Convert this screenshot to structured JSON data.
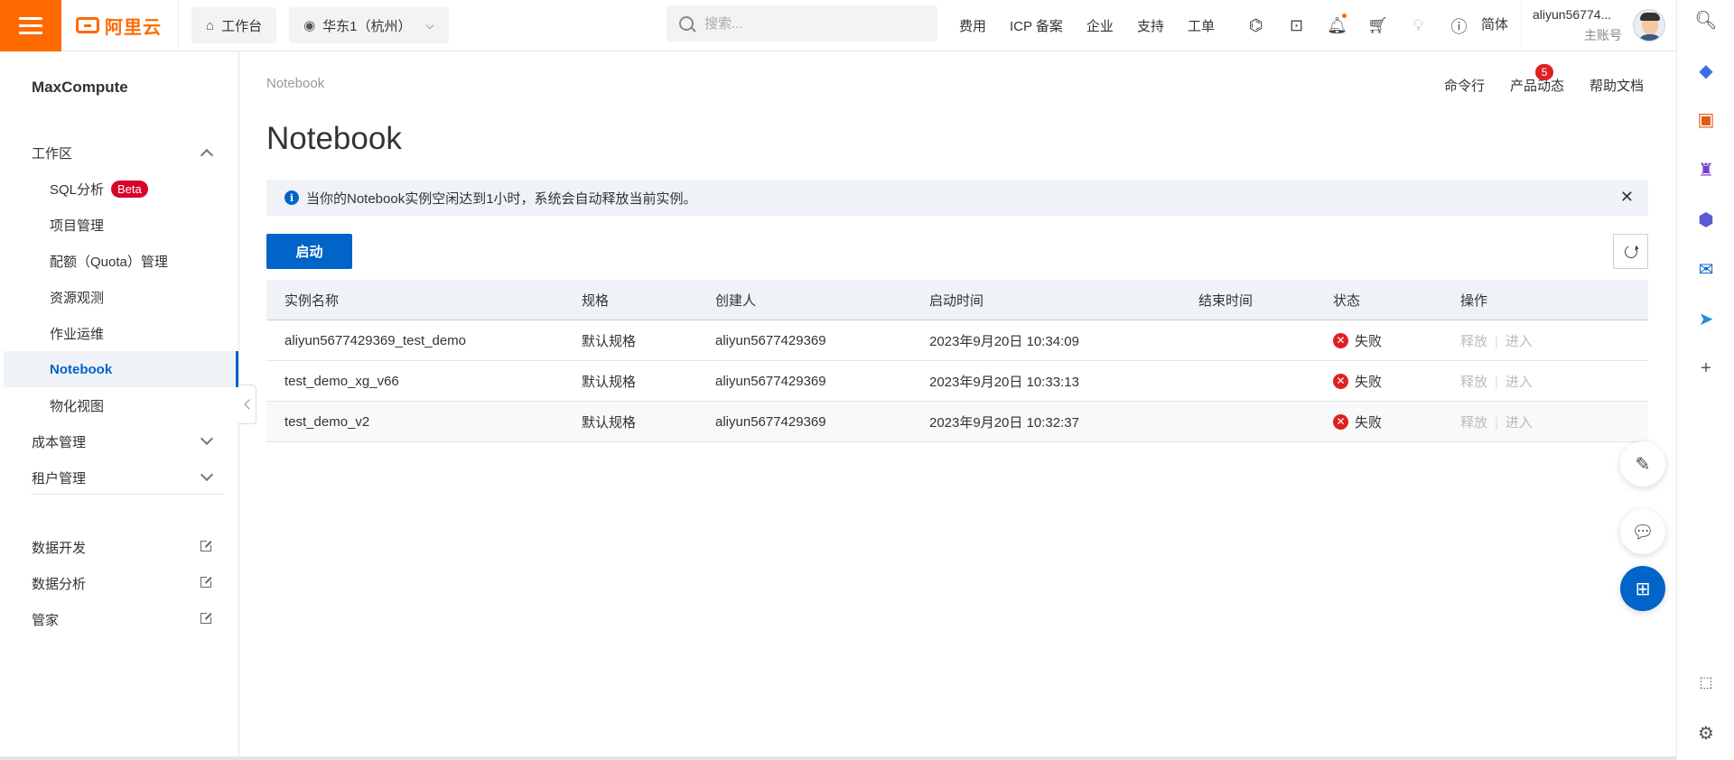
{
  "topbar": {
    "logo": "阿里云",
    "workbench": "工作台",
    "region": "华东1（杭州）",
    "search_placeholder": "搜索...",
    "links": [
      "费用",
      "ICP 备案",
      "企业",
      "支持",
      "工单"
    ],
    "lang": "简体",
    "username": "aliyun56774...",
    "role": "主账号"
  },
  "sidebar": {
    "product": "MaxCompute",
    "group_workspace": "工作区",
    "sql_analysis": "SQL分析",
    "beta": "Beta",
    "project_mgmt": "项目管理",
    "quota_mgmt": "配额（Quota）管理",
    "resource_observe": "资源观测",
    "job_ops": "作业运维",
    "notebook": "Notebook",
    "materialized_view": "物化视图",
    "cost_mgmt": "成本管理",
    "tenant_mgmt": "租户管理",
    "data_dev": "数据开发",
    "data_analysis": "数据分析",
    "butler": "管家"
  },
  "main": {
    "breadcrumb": "Notebook",
    "cmdline": "命令行",
    "product_news": "产品动态",
    "news_count": "5",
    "help_docs": "帮助文档",
    "title": "Notebook",
    "notice": "当你的Notebook实例空闲达到1小时，系统会自动释放当前实例。",
    "start_button": "启动"
  },
  "table": {
    "headers": [
      "实例名称",
      "规格",
      "创建人",
      "启动时间",
      "结束时间",
      "状态",
      "操作"
    ],
    "rows": [
      {
        "name": "aliyun5677429369_test_demo",
        "spec": "默认规格",
        "creator": "aliyun5677429369",
        "start": "2023年9月20日 10:34:09",
        "end": "",
        "status": "失败",
        "release": "释放",
        "enter": "进入"
      },
      {
        "name": "test_demo_xg_v66",
        "spec": "默认规格",
        "creator": "aliyun5677429369",
        "start": "2023年9月20日 10:33:13",
        "end": "",
        "status": "失败",
        "release": "释放",
        "enter": "进入"
      },
      {
        "name": "test_demo_v2",
        "spec": "默认规格",
        "creator": "aliyun5677429369",
        "start": "2023年9月20日 10:32:37",
        "end": "",
        "status": "失败",
        "release": "释放",
        "enter": "进入"
      }
    ]
  },
  "colors": {
    "brand_orange": "#ff6a00",
    "primary_blue": "#0064c8",
    "error_red": "#e02020"
  }
}
